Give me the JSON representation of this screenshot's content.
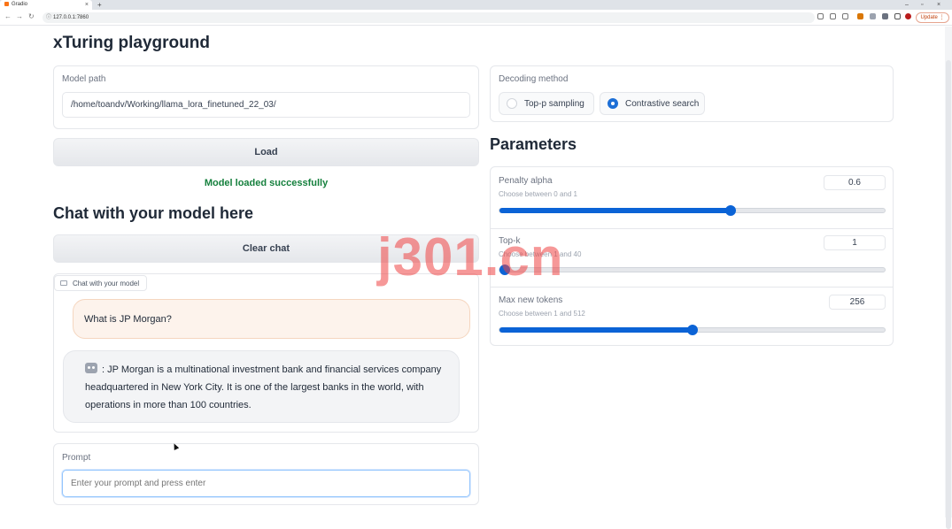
{
  "browser": {
    "tab_title": "Gradio",
    "tab_close": "×",
    "new_tab": "+",
    "url": "127.0.0.1:7860",
    "update_label": "Update",
    "win_min": "–",
    "win_max": "▫",
    "win_close": "×"
  },
  "app": {
    "title": "xTuring playground"
  },
  "model_path": {
    "label": "Model path",
    "value": "/home/toandv/Working/llama_lora_finetuned_22_03/"
  },
  "load_button": "Load",
  "status_message": "Model loaded successfully",
  "chat_section": {
    "heading": "Chat with your model here",
    "clear_button": "Clear chat",
    "chatbot_label": "Chat with your model",
    "messages": [
      {
        "role": "user",
        "text": "What is JP Morgan?"
      },
      {
        "role": "bot",
        "prefix": " : ",
        "text": "JP Morgan is a multinational investment bank and financial services company headquartered in New York City. It is one of the largest banks in the world, with operations in more than 100 countries."
      }
    ]
  },
  "prompt": {
    "label": "Prompt",
    "placeholder": "Enter your prompt and press enter"
  },
  "decoding": {
    "label": "Decoding method",
    "options": [
      "Top-p sampling",
      "Contrastive search"
    ],
    "selected": "Contrastive search"
  },
  "parameters": {
    "heading": "Parameters",
    "sliders": [
      {
        "label": "Penalty alpha",
        "hint": "Choose between 0 and 1",
        "value": "0.6",
        "min": 0,
        "max": 1,
        "fraction": 0.6
      },
      {
        "label": "Top-k",
        "hint": "Choose between 1 and 40",
        "value": "1",
        "min": 1,
        "max": 40,
        "fraction": 0.0
      },
      {
        "label": "Max new tokens",
        "hint": "Choose between 1 and 512",
        "value": "256",
        "min": 1,
        "max": 512,
        "fraction": 0.5
      }
    ]
  },
  "watermark": "j301.cn"
}
